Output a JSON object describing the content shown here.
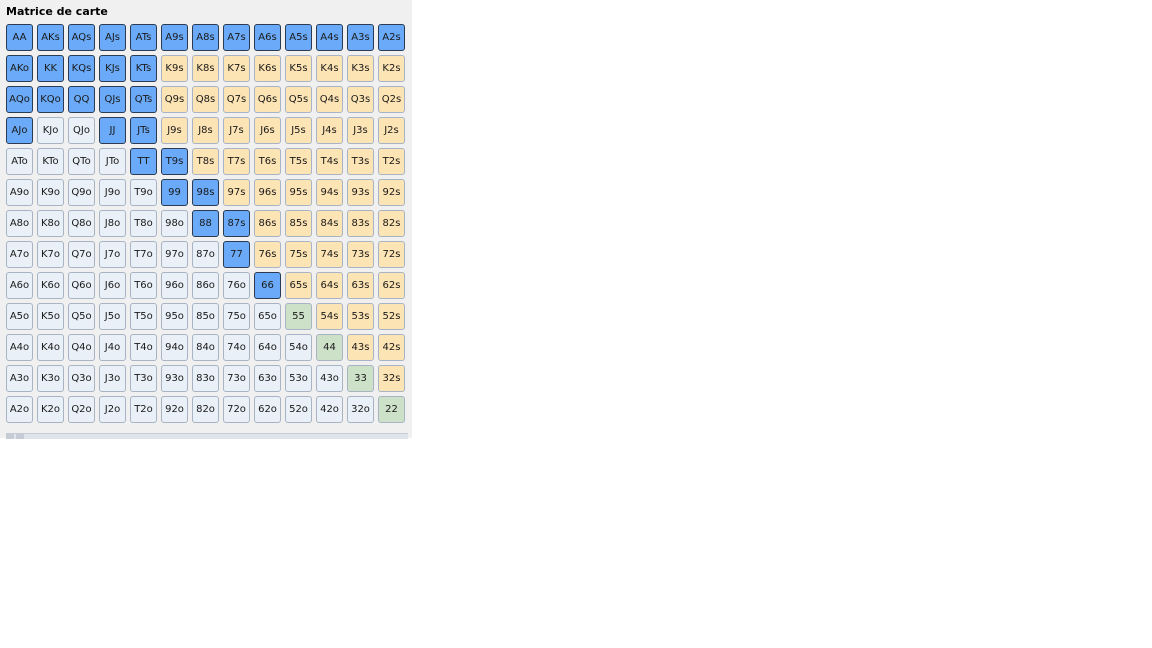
{
  "panel": {
    "title": "Matrice de carte"
  },
  "colors": {
    "selected": "#6aaaf8",
    "suited": "#fde4b4",
    "pair": "#cde0c8",
    "offsuit": "#e9f0f7"
  },
  "matrix": {
    "rows": [
      [
        [
          "AA",
          "selected"
        ],
        [
          "AKs",
          "selected"
        ],
        [
          "AQs",
          "selected"
        ],
        [
          "AJs",
          "selected"
        ],
        [
          "ATs",
          "selected"
        ],
        [
          "A9s",
          "selected"
        ],
        [
          "A8s",
          "selected"
        ],
        [
          "A7s",
          "selected"
        ],
        [
          "A6s",
          "selected"
        ],
        [
          "A5s",
          "selected"
        ],
        [
          "A4s",
          "selected"
        ],
        [
          "A3s",
          "selected"
        ],
        [
          "A2s",
          "selected"
        ]
      ],
      [
        [
          "AKo",
          "selected"
        ],
        [
          "KK",
          "selected"
        ],
        [
          "KQs",
          "selected"
        ],
        [
          "KJs",
          "selected"
        ],
        [
          "KTs",
          "selected"
        ],
        [
          "K9s",
          "suited"
        ],
        [
          "K8s",
          "suited"
        ],
        [
          "K7s",
          "suited"
        ],
        [
          "K6s",
          "suited"
        ],
        [
          "K5s",
          "suited"
        ],
        [
          "K4s",
          "suited"
        ],
        [
          "K3s",
          "suited"
        ],
        [
          "K2s",
          "suited"
        ]
      ],
      [
        [
          "AQo",
          "selected"
        ],
        [
          "KQo",
          "selected"
        ],
        [
          "QQ",
          "selected"
        ],
        [
          "QJs",
          "selected"
        ],
        [
          "QTs",
          "selected"
        ],
        [
          "Q9s",
          "suited"
        ],
        [
          "Q8s",
          "suited"
        ],
        [
          "Q7s",
          "suited"
        ],
        [
          "Q6s",
          "suited"
        ],
        [
          "Q5s",
          "suited"
        ],
        [
          "Q4s",
          "suited"
        ],
        [
          "Q3s",
          "suited"
        ],
        [
          "Q2s",
          "suited"
        ]
      ],
      [
        [
          "AJo",
          "selected"
        ],
        [
          "KJo",
          "offsuit"
        ],
        [
          "QJo",
          "offsuit"
        ],
        [
          "JJ",
          "selected"
        ],
        [
          "JTs",
          "selected"
        ],
        [
          "J9s",
          "suited"
        ],
        [
          "J8s",
          "suited"
        ],
        [
          "J7s",
          "suited"
        ],
        [
          "J6s",
          "suited"
        ],
        [
          "J5s",
          "suited"
        ],
        [
          "J4s",
          "suited"
        ],
        [
          "J3s",
          "suited"
        ],
        [
          "J2s",
          "suited"
        ]
      ],
      [
        [
          "ATo",
          "offsuit"
        ],
        [
          "KTo",
          "offsuit"
        ],
        [
          "QTo",
          "offsuit"
        ],
        [
          "JTo",
          "offsuit"
        ],
        [
          "TT",
          "selected"
        ],
        [
          "T9s",
          "selected"
        ],
        [
          "T8s",
          "suited"
        ],
        [
          "T7s",
          "suited"
        ],
        [
          "T6s",
          "suited"
        ],
        [
          "T5s",
          "suited"
        ],
        [
          "T4s",
          "suited"
        ],
        [
          "T3s",
          "suited"
        ],
        [
          "T2s",
          "suited"
        ]
      ],
      [
        [
          "A9o",
          "offsuit"
        ],
        [
          "K9o",
          "offsuit"
        ],
        [
          "Q9o",
          "offsuit"
        ],
        [
          "J9o",
          "offsuit"
        ],
        [
          "T9o",
          "offsuit"
        ],
        [
          "99",
          "selected"
        ],
        [
          "98s",
          "selected"
        ],
        [
          "97s",
          "suited"
        ],
        [
          "96s",
          "suited"
        ],
        [
          "95s",
          "suited"
        ],
        [
          "94s",
          "suited"
        ],
        [
          "93s",
          "suited"
        ],
        [
          "92s",
          "suited"
        ]
      ],
      [
        [
          "A8o",
          "offsuit"
        ],
        [
          "K8o",
          "offsuit"
        ],
        [
          "Q8o",
          "offsuit"
        ],
        [
          "J8o",
          "offsuit"
        ],
        [
          "T8o",
          "offsuit"
        ],
        [
          "98o",
          "offsuit"
        ],
        [
          "88",
          "selected"
        ],
        [
          "87s",
          "selected"
        ],
        [
          "86s",
          "suited"
        ],
        [
          "85s",
          "suited"
        ],
        [
          "84s",
          "suited"
        ],
        [
          "83s",
          "suited"
        ],
        [
          "82s",
          "suited"
        ]
      ],
      [
        [
          "A7o",
          "offsuit"
        ],
        [
          "K7o",
          "offsuit"
        ],
        [
          "Q7o",
          "offsuit"
        ],
        [
          "J7o",
          "offsuit"
        ],
        [
          "T7o",
          "offsuit"
        ],
        [
          "97o",
          "offsuit"
        ],
        [
          "87o",
          "offsuit"
        ],
        [
          "77",
          "selected"
        ],
        [
          "76s",
          "suited"
        ],
        [
          "75s",
          "suited"
        ],
        [
          "74s",
          "suited"
        ],
        [
          "73s",
          "suited"
        ],
        [
          "72s",
          "suited"
        ]
      ],
      [
        [
          "A6o",
          "offsuit"
        ],
        [
          "K6o",
          "offsuit"
        ],
        [
          "Q6o",
          "offsuit"
        ],
        [
          "J6o",
          "offsuit"
        ],
        [
          "T6o",
          "offsuit"
        ],
        [
          "96o",
          "offsuit"
        ],
        [
          "86o",
          "offsuit"
        ],
        [
          "76o",
          "offsuit"
        ],
        [
          "66",
          "selected"
        ],
        [
          "65s",
          "suited"
        ],
        [
          "64s",
          "suited"
        ],
        [
          "63s",
          "suited"
        ],
        [
          "62s",
          "suited"
        ]
      ],
      [
        [
          "A5o",
          "offsuit"
        ],
        [
          "K5o",
          "offsuit"
        ],
        [
          "Q5o",
          "offsuit"
        ],
        [
          "J5o",
          "offsuit"
        ],
        [
          "T5o",
          "offsuit"
        ],
        [
          "95o",
          "offsuit"
        ],
        [
          "85o",
          "offsuit"
        ],
        [
          "75o",
          "offsuit"
        ],
        [
          "65o",
          "offsuit"
        ],
        [
          "55",
          "pair"
        ],
        [
          "54s",
          "suited"
        ],
        [
          "53s",
          "suited"
        ],
        [
          "52s",
          "suited"
        ]
      ],
      [
        [
          "A4o",
          "offsuit"
        ],
        [
          "K4o",
          "offsuit"
        ],
        [
          "Q4o",
          "offsuit"
        ],
        [
          "J4o",
          "offsuit"
        ],
        [
          "T4o",
          "offsuit"
        ],
        [
          "94o",
          "offsuit"
        ],
        [
          "84o",
          "offsuit"
        ],
        [
          "74o",
          "offsuit"
        ],
        [
          "64o",
          "offsuit"
        ],
        [
          "54o",
          "offsuit"
        ],
        [
          "44",
          "pair"
        ],
        [
          "43s",
          "suited"
        ],
        [
          "42s",
          "suited"
        ]
      ],
      [
        [
          "A3o",
          "offsuit"
        ],
        [
          "K3o",
          "offsuit"
        ],
        [
          "Q3o",
          "offsuit"
        ],
        [
          "J3o",
          "offsuit"
        ],
        [
          "T3o",
          "offsuit"
        ],
        [
          "93o",
          "offsuit"
        ],
        [
          "83o",
          "offsuit"
        ],
        [
          "73o",
          "offsuit"
        ],
        [
          "63o",
          "offsuit"
        ],
        [
          "53o",
          "offsuit"
        ],
        [
          "43o",
          "offsuit"
        ],
        [
          "33",
          "pair"
        ],
        [
          "32s",
          "suited"
        ]
      ],
      [
        [
          "A2o",
          "offsuit"
        ],
        [
          "K2o",
          "offsuit"
        ],
        [
          "Q2o",
          "offsuit"
        ],
        [
          "J2o",
          "offsuit"
        ],
        [
          "T2o",
          "offsuit"
        ],
        [
          "92o",
          "offsuit"
        ],
        [
          "82o",
          "offsuit"
        ],
        [
          "72o",
          "offsuit"
        ],
        [
          "62o",
          "offsuit"
        ],
        [
          "52o",
          "offsuit"
        ],
        [
          "42o",
          "offsuit"
        ],
        [
          "32o",
          "offsuit"
        ],
        [
          "22",
          "pair"
        ]
      ]
    ]
  }
}
